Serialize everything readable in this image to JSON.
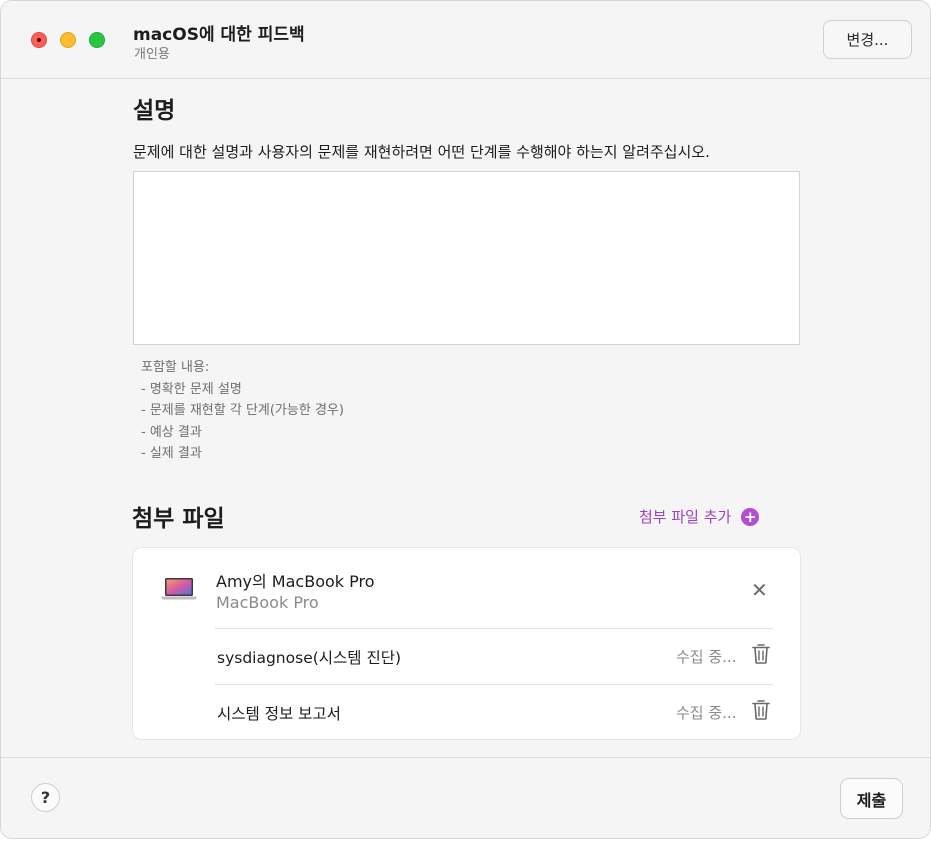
{
  "window": {
    "title": "macOS에 대한 피드백",
    "subtitle": "개인용",
    "change_label": "변경..."
  },
  "description": {
    "title": "설명",
    "prompt": "문제에 대한 설명과 사용자의 문제를 재현하려면 어떤 단계를 수행해야 하는지 알려주십시오.",
    "value": "",
    "hints": [
      "포함할 내용:",
      "- 명확한 문제 설명",
      "- 문제를 재현할 각 단계(가능한 경우)",
      "- 예상 결과",
      "- 실제 결과"
    ]
  },
  "attachments": {
    "title": "첨부 파일",
    "add_label": "첨부 파일 추가",
    "device": {
      "name": "Amy의 MacBook Pro",
      "model": "MacBook Pro"
    },
    "items": [
      {
        "label": "sysdiagnose(시스템 진단)",
        "status": "수집 중..."
      },
      {
        "label": "시스템 정보 보고서",
        "status": "수집 중..."
      }
    ]
  },
  "footer": {
    "help_label": "?",
    "submit_label": "제출"
  },
  "colors": {
    "accent": "#b04fd3",
    "window_bg": "#f5f5f5"
  }
}
